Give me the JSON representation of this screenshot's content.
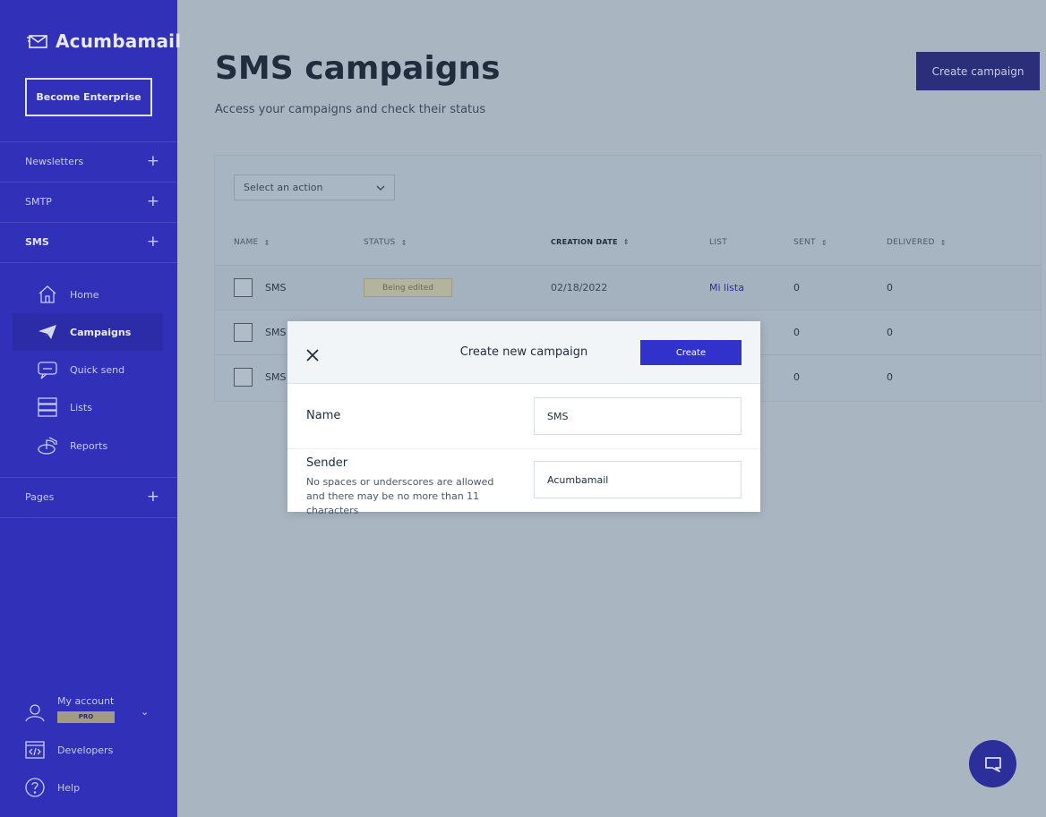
{
  "sidebar": {
    "brand": "Acumbamail",
    "enterprise_button": "Become Enterprise",
    "sections": [
      {
        "label": "Newsletters"
      },
      {
        "label": "SMTP"
      },
      {
        "label": "SMS"
      },
      {
        "label": "Pages"
      }
    ],
    "sms_items": [
      {
        "label": "Home",
        "icon": "home-icon"
      },
      {
        "label": "Campaigns",
        "icon": "paper-plane-icon",
        "active": true
      },
      {
        "label": "Quick send",
        "icon": "chat-bubble-icon"
      },
      {
        "label": "Lists",
        "icon": "list-icon"
      },
      {
        "label": "Reports",
        "icon": "pie-chart-icon"
      }
    ],
    "account": {
      "label": "My account",
      "plan_badge": "PRO"
    },
    "developers": "Developers",
    "help": "Help"
  },
  "header": {
    "title": "SMS campaigns",
    "subtitle": "Access your campaigns and check their status",
    "create_button": "Create campaign"
  },
  "table": {
    "action_select_placeholder": "Select an action",
    "columns": [
      "NAME",
      "STATUS",
      "CREATION DATE",
      "LIST",
      "SENT",
      "DELIVERED"
    ],
    "rows": [
      {
        "name": "SMS",
        "status": "Being edited",
        "date": "02/18/2022",
        "list": "Mi lista",
        "sent": "0",
        "delivered": "0"
      },
      {
        "name": "SMS",
        "sent": "0",
        "delivered": "0"
      },
      {
        "name": "SMS",
        "sent": "0",
        "delivered": "0"
      }
    ]
  },
  "modal": {
    "title": "Create new campaign",
    "create_button": "Create",
    "name_label": "Name",
    "name_value": "SMS",
    "sender_label": "Sender",
    "sender_help": "No spaces or underscores are allowed and there may be no more than 11 characters",
    "sender_value": "Acumbamail"
  },
  "colors": {
    "sidebar_bg": "#3030b8",
    "overlay_bg": "#a9b6c2",
    "primary": "#3131cc"
  }
}
